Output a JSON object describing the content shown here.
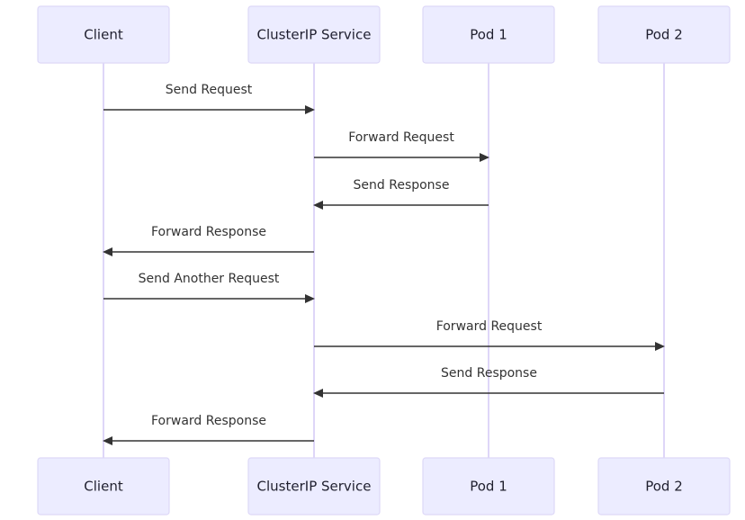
{
  "diagram": {
    "type": "sequence",
    "participants": [
      {
        "id": "client",
        "label": "Client"
      },
      {
        "id": "svc",
        "label": "ClusterIP Service"
      },
      {
        "id": "pod1",
        "label": "Pod 1"
      },
      {
        "id": "pod2",
        "label": "Pod 2"
      }
    ],
    "messages": [
      {
        "from": "client",
        "to": "svc",
        "label": "Send Request"
      },
      {
        "from": "svc",
        "to": "pod1",
        "label": "Forward Request"
      },
      {
        "from": "pod1",
        "to": "svc",
        "label": "Send Response"
      },
      {
        "from": "svc",
        "to": "client",
        "label": "Forward Response"
      },
      {
        "from": "client",
        "to": "svc",
        "label": "Send Another Request"
      },
      {
        "from": "svc",
        "to": "pod2",
        "label": "Forward Request"
      },
      {
        "from": "pod2",
        "to": "svc",
        "label": "Send Response"
      },
      {
        "from": "svc",
        "to": "client",
        "label": "Forward Response"
      }
    ],
    "colors": {
      "actor_fill": "#ECECFF",
      "actor_border": "#DDD8F7",
      "lifeline": "#D6CCF7",
      "message": "#333333"
    }
  }
}
